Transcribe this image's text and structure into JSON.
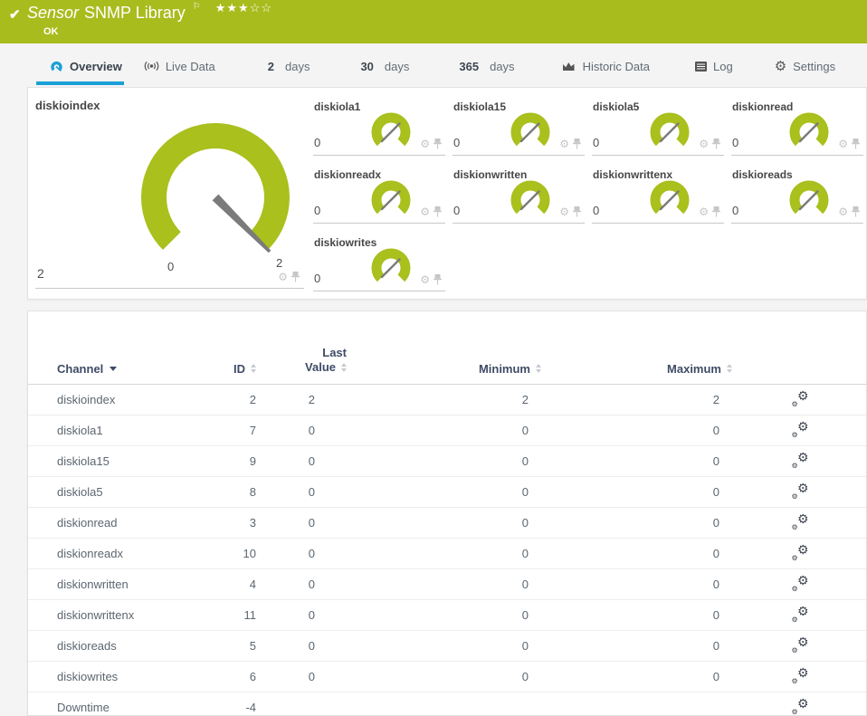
{
  "colors": {
    "brand_green": "#a9bc1e",
    "gauge_green": "#a9c01d",
    "accent_blue": "#1aa0d8"
  },
  "icons": {
    "check": "✔",
    "flag": "⚐",
    "gear": "⚙",
    "stars_filled": "★★★",
    "stars_empty": "☆☆"
  },
  "header": {
    "title_italic": "Sensor",
    "title": "SNMP Library",
    "status": "OK"
  },
  "tabs": [
    {
      "label": "Overview"
    },
    {
      "label": "Live Data"
    },
    {
      "value": "2",
      "unit": "days"
    },
    {
      "value": "30",
      "unit": "days"
    },
    {
      "value": "365",
      "unit": "days"
    },
    {
      "label": "Historic Data"
    },
    {
      "label": "Log"
    },
    {
      "label": "Settings"
    }
  ],
  "gauges": {
    "main": {
      "title": "diskioindex",
      "value": "2",
      "scale_min": "0",
      "scale_max": "2"
    },
    "small": [
      {
        "title": "diskiola1",
        "value": "0"
      },
      {
        "title": "diskiola15",
        "value": "0"
      },
      {
        "title": "diskiola5",
        "value": "0"
      },
      {
        "title": "diskionread",
        "value": "0"
      },
      {
        "title": "diskionreadx",
        "value": "0"
      },
      {
        "title": "diskionwritten",
        "value": "0"
      },
      {
        "title": "diskionwrittenx",
        "value": "0"
      },
      {
        "title": "diskioreads",
        "value": "0"
      },
      {
        "title": "diskiowrites",
        "value": "0"
      }
    ]
  },
  "table": {
    "header": {
      "channel": "Channel",
      "id": "ID",
      "last_line1": "Last",
      "last_line2": "Value",
      "minimum": "Minimum",
      "maximum": "Maximum"
    },
    "rows": [
      {
        "channel": "diskioindex",
        "id": "2",
        "last": "2",
        "min": "2",
        "max": "2"
      },
      {
        "channel": "diskiola1",
        "id": "7",
        "last": "0",
        "min": "0",
        "max": "0"
      },
      {
        "channel": "diskiola15",
        "id": "9",
        "last": "0",
        "min": "0",
        "max": "0"
      },
      {
        "channel": "diskiola5",
        "id": "8",
        "last": "0",
        "min": "0",
        "max": "0"
      },
      {
        "channel": "diskionread",
        "id": "3",
        "last": "0",
        "min": "0",
        "max": "0"
      },
      {
        "channel": "diskionreadx",
        "id": "10",
        "last": "0",
        "min": "0",
        "max": "0"
      },
      {
        "channel": "diskionwritten",
        "id": "4",
        "last": "0",
        "min": "0",
        "max": "0"
      },
      {
        "channel": "diskionwrittenx",
        "id": "11",
        "last": "0",
        "min": "0",
        "max": "0"
      },
      {
        "channel": "diskioreads",
        "id": "5",
        "last": "0",
        "min": "0",
        "max": "0"
      },
      {
        "channel": "diskiowrites",
        "id": "6",
        "last": "0",
        "min": "0",
        "max": "0"
      },
      {
        "channel": "Downtime",
        "id": "-4",
        "last": "",
        "min": "",
        "max": ""
      }
    ]
  }
}
